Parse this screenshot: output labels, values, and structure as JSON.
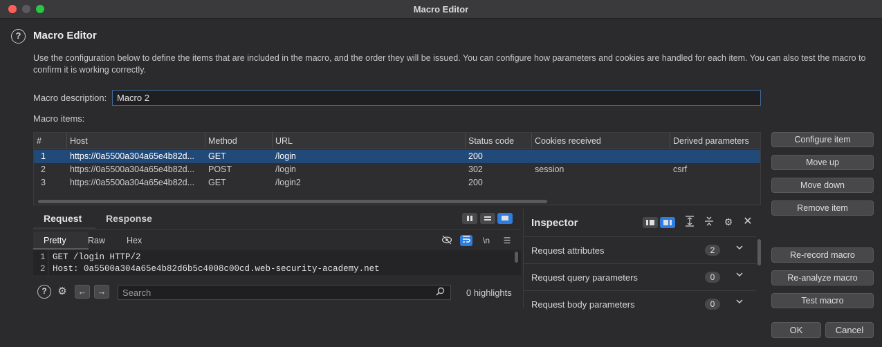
{
  "window": {
    "title": "Macro Editor"
  },
  "header": {
    "help_glyph": "?",
    "title": "Macro Editor",
    "description": "Use the configuration below to define the items that are included in the macro, and the order they will be issued. You can configure how parameters and cookies are handled for each item. You can also test the macro to confirm it is working correctly."
  },
  "macro_description": {
    "label": "Macro description:",
    "value": "Macro 2"
  },
  "macro_items": {
    "label": "Macro items:",
    "columns": [
      "#",
      "Host",
      "Method",
      "URL",
      "Status code",
      "Cookies received",
      "Derived parameters"
    ],
    "rows": [
      {
        "num": "1",
        "host": "https://0a5500a304a65e4b82d...",
        "method": "GET",
        "url": "/login",
        "status": "200",
        "cookies": "",
        "derived": "",
        "selected": true
      },
      {
        "num": "2",
        "host": "https://0a5500a304a65e4b82d...",
        "method": "POST",
        "url": "/login",
        "status": "302",
        "cookies": "session",
        "derived": "csrf",
        "selected": false
      },
      {
        "num": "3",
        "host": "https://0a5500a304a65e4b82d...",
        "method": "GET",
        "url": "/login2",
        "status": "200",
        "cookies": "",
        "derived": "",
        "selected": false
      }
    ]
  },
  "side_buttons": {
    "configure_item": "Configure item",
    "move_up": "Move up",
    "move_down": "Move down",
    "remove_item": "Remove item",
    "re_record": "Re-record macro",
    "re_analyze": "Re-analyze macro",
    "test_macro": "Test macro"
  },
  "request_panel": {
    "tabs": [
      "Request",
      "Response"
    ],
    "active_tab": "Request",
    "subtabs": [
      "Pretty",
      "Raw",
      "Hex"
    ],
    "active_subtab": "Pretty",
    "newline_glyph": "\\n",
    "lines": [
      {
        "num": "1",
        "text": "GET /login HTTP/2"
      },
      {
        "num": "2",
        "text": "Host: 0a5500a304a65e4b82d6b5c4008c00cd.web-security-academy.net"
      }
    ],
    "search_placeholder": "Search",
    "highlights": "0 highlights"
  },
  "inspector": {
    "title": "Inspector",
    "sections": [
      {
        "label": "Request attributes",
        "count": "2"
      },
      {
        "label": "Request query parameters",
        "count": "0"
      },
      {
        "label": "Request body parameters",
        "count": "0"
      }
    ]
  },
  "footer": {
    "ok": "OK",
    "cancel": "Cancel"
  },
  "colors": {
    "selection": "#224a78",
    "accent": "#2f7ce0",
    "background": "#2b2b2d"
  }
}
